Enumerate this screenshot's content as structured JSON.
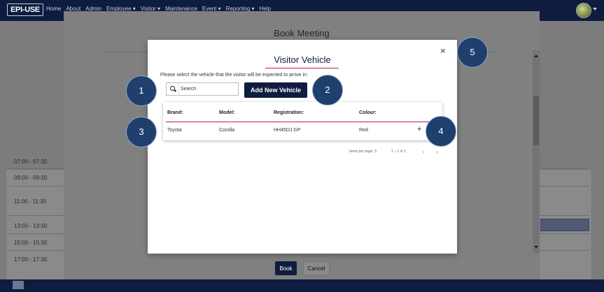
{
  "nav": {
    "logo": "EPI-USE",
    "items": [
      "Home",
      "About",
      "Admin",
      "Employee ▾",
      "Visitor ▾",
      "Maintenance",
      "Event ▾",
      "Reporting ▾",
      "Help"
    ]
  },
  "background": {
    "timeslots": [
      "07:00 - 07:30",
      "09:00 - 09:30",
      "11:00 - 11:30",
      "13:00 - 13:30",
      "15:00 - 15:30",
      "17:00 - 17:30"
    ]
  },
  "book_meeting": {
    "title": "Book Meeting",
    "book_label": "Book",
    "cancel_label": "Cancel"
  },
  "dialog": {
    "title": "Visitor Vehicle",
    "close_glyph": "×",
    "instruction": "Please select the vehicle that the visitor will be expected to arrive in:",
    "search_placeholder": "Search",
    "add_button_label": "Add New Vehicle",
    "columns": [
      "Brand:",
      "Model:",
      "Registration:",
      "Colour:"
    ],
    "rows": [
      {
        "brand": "Toyota",
        "model": "Corolla",
        "registration": "HH45DJ GP",
        "colour": "Red",
        "action_glyph": "+"
      }
    ],
    "paginator": {
      "items_per_page": "Items per page: 3",
      "range": "1 – 1 of 1",
      "prev_glyph": "‹",
      "next_glyph": "›"
    }
  },
  "callouts": [
    "1",
    "2",
    "3",
    "4",
    "5"
  ],
  "colors": {
    "navy": "#0d1c3f",
    "accent": "#c2185b",
    "callout": "#1f3f6d"
  }
}
